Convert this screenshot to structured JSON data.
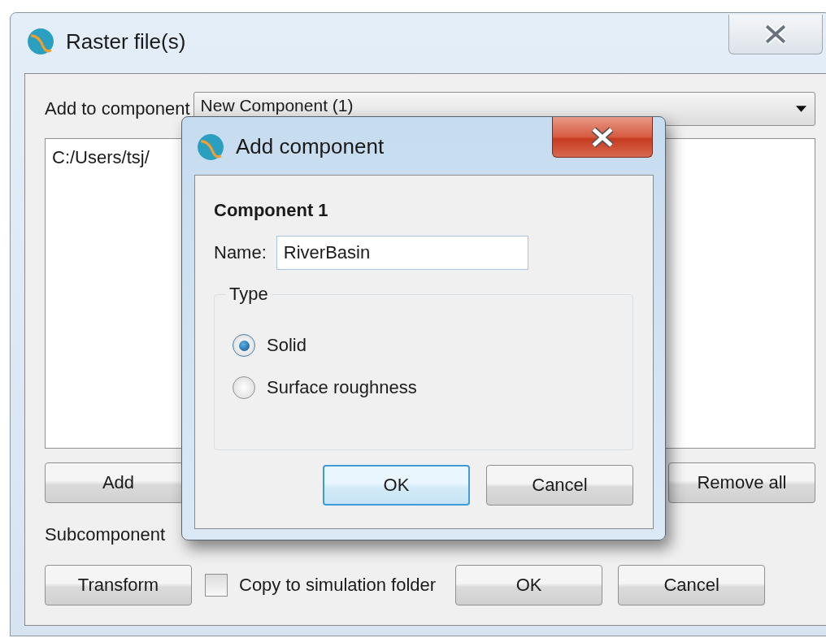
{
  "window": {
    "title": "Raster file(s)"
  },
  "add_to_component": {
    "label": "Add to component",
    "value": "New Component (1)"
  },
  "file_list": [
    "C:/Users/tsj/"
  ],
  "buttons": [
    {
      "label": "Add"
    },
    {
      "label": "Remove all"
    }
  ],
  "subcomponent_label": "Subcomponent",
  "transform_button": "Transform",
  "copy_checkbox": {
    "label": "Copy to simulation folder",
    "checked": false
  },
  "footer_buttons": [
    "OK",
    "Cancel"
  ],
  "dialog": {
    "title": "Add component",
    "heading": "Component 1",
    "name_label": "Name:",
    "name_value": "RiverBasin",
    "type_group": "Type",
    "types": [
      {
        "label": "Solid",
        "selected": true
      },
      {
        "label": "Surface roughness",
        "selected": false
      }
    ],
    "buttons": [
      {
        "label": "OK",
        "focused": true
      },
      {
        "label": "Cancel",
        "focused": false
      }
    ]
  }
}
